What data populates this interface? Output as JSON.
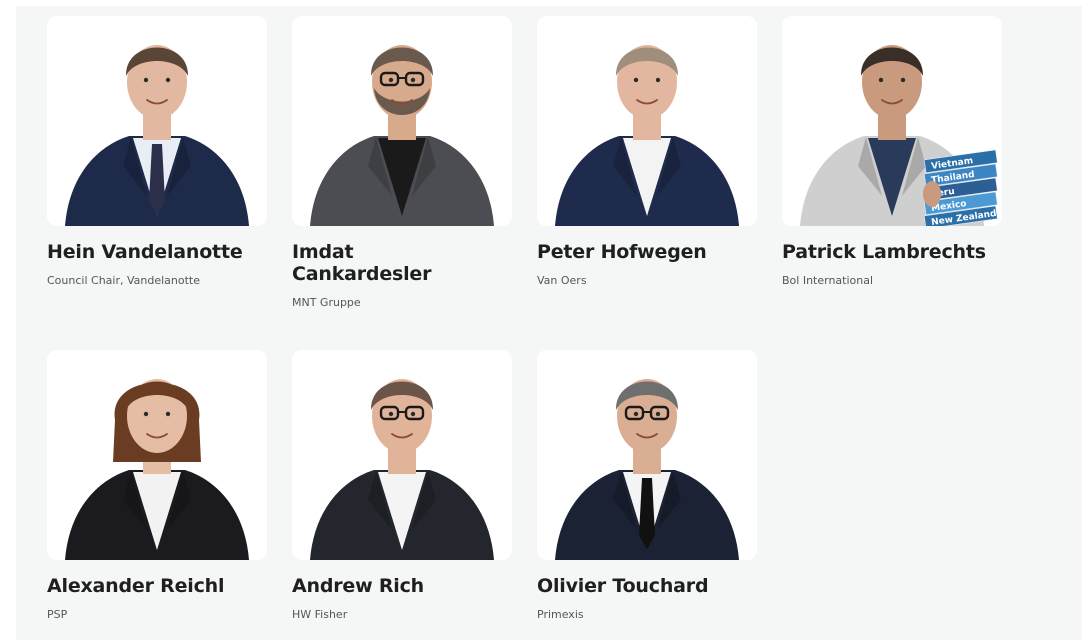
{
  "members": [
    {
      "name": "Hein Vandelanotte",
      "org": "Council Chair, Vandelanotte",
      "suit": "#1e2a4a",
      "shirt": "#e9eef6",
      "tie": "#2c2f4a",
      "hair": "#5a4636",
      "skin": "#e2b8a0"
    },
    {
      "name": "Imdat Cankardesler",
      "org": "MNT Gruppe",
      "suit": "#4b4d52",
      "shirt": "#1a1a1a",
      "tie": "",
      "hair": "#6a5a4e",
      "skin": "#d8aa8c"
    },
    {
      "name": "Peter Hofwegen",
      "org": "Van Oers",
      "suit": "#1f2b4c",
      "shirt": "#f3f3f3",
      "tie": "",
      "hair": "#a08e7c",
      "skin": "#e3b79f"
    },
    {
      "name": "Patrick Lambrechts",
      "org": "Bol International",
      "suit": "#cfcfcf",
      "shirt": "#2a3a5a",
      "tie": "",
      "hair": "#3a2e28",
      "skin": "#c99a7e"
    },
    {
      "name": "Alexander Reichl",
      "org": "PSP",
      "suit": "#1b1b1f",
      "shirt": "#f2f2f2",
      "tie": "",
      "hair": "#6a3c22",
      "skin": "#e5bca4"
    },
    {
      "name": "Andrew Rich",
      "org": "HW Fisher",
      "suit": "#23262d",
      "shirt": "#f4f4f4",
      "tie": "",
      "hair": "#6b5448",
      "skin": "#e1b49a"
    },
    {
      "name": "Olivier Touchard",
      "org": "Primexis",
      "suit": "#1b2233",
      "shirt": "#f4f4f4",
      "tie": "#111111",
      "hair": "#6f6f6f",
      "skin": "#d9ae92"
    }
  ],
  "books": [
    "Vietnam",
    "Thailand",
    "Peru",
    "Mexico",
    "New Zealand"
  ]
}
